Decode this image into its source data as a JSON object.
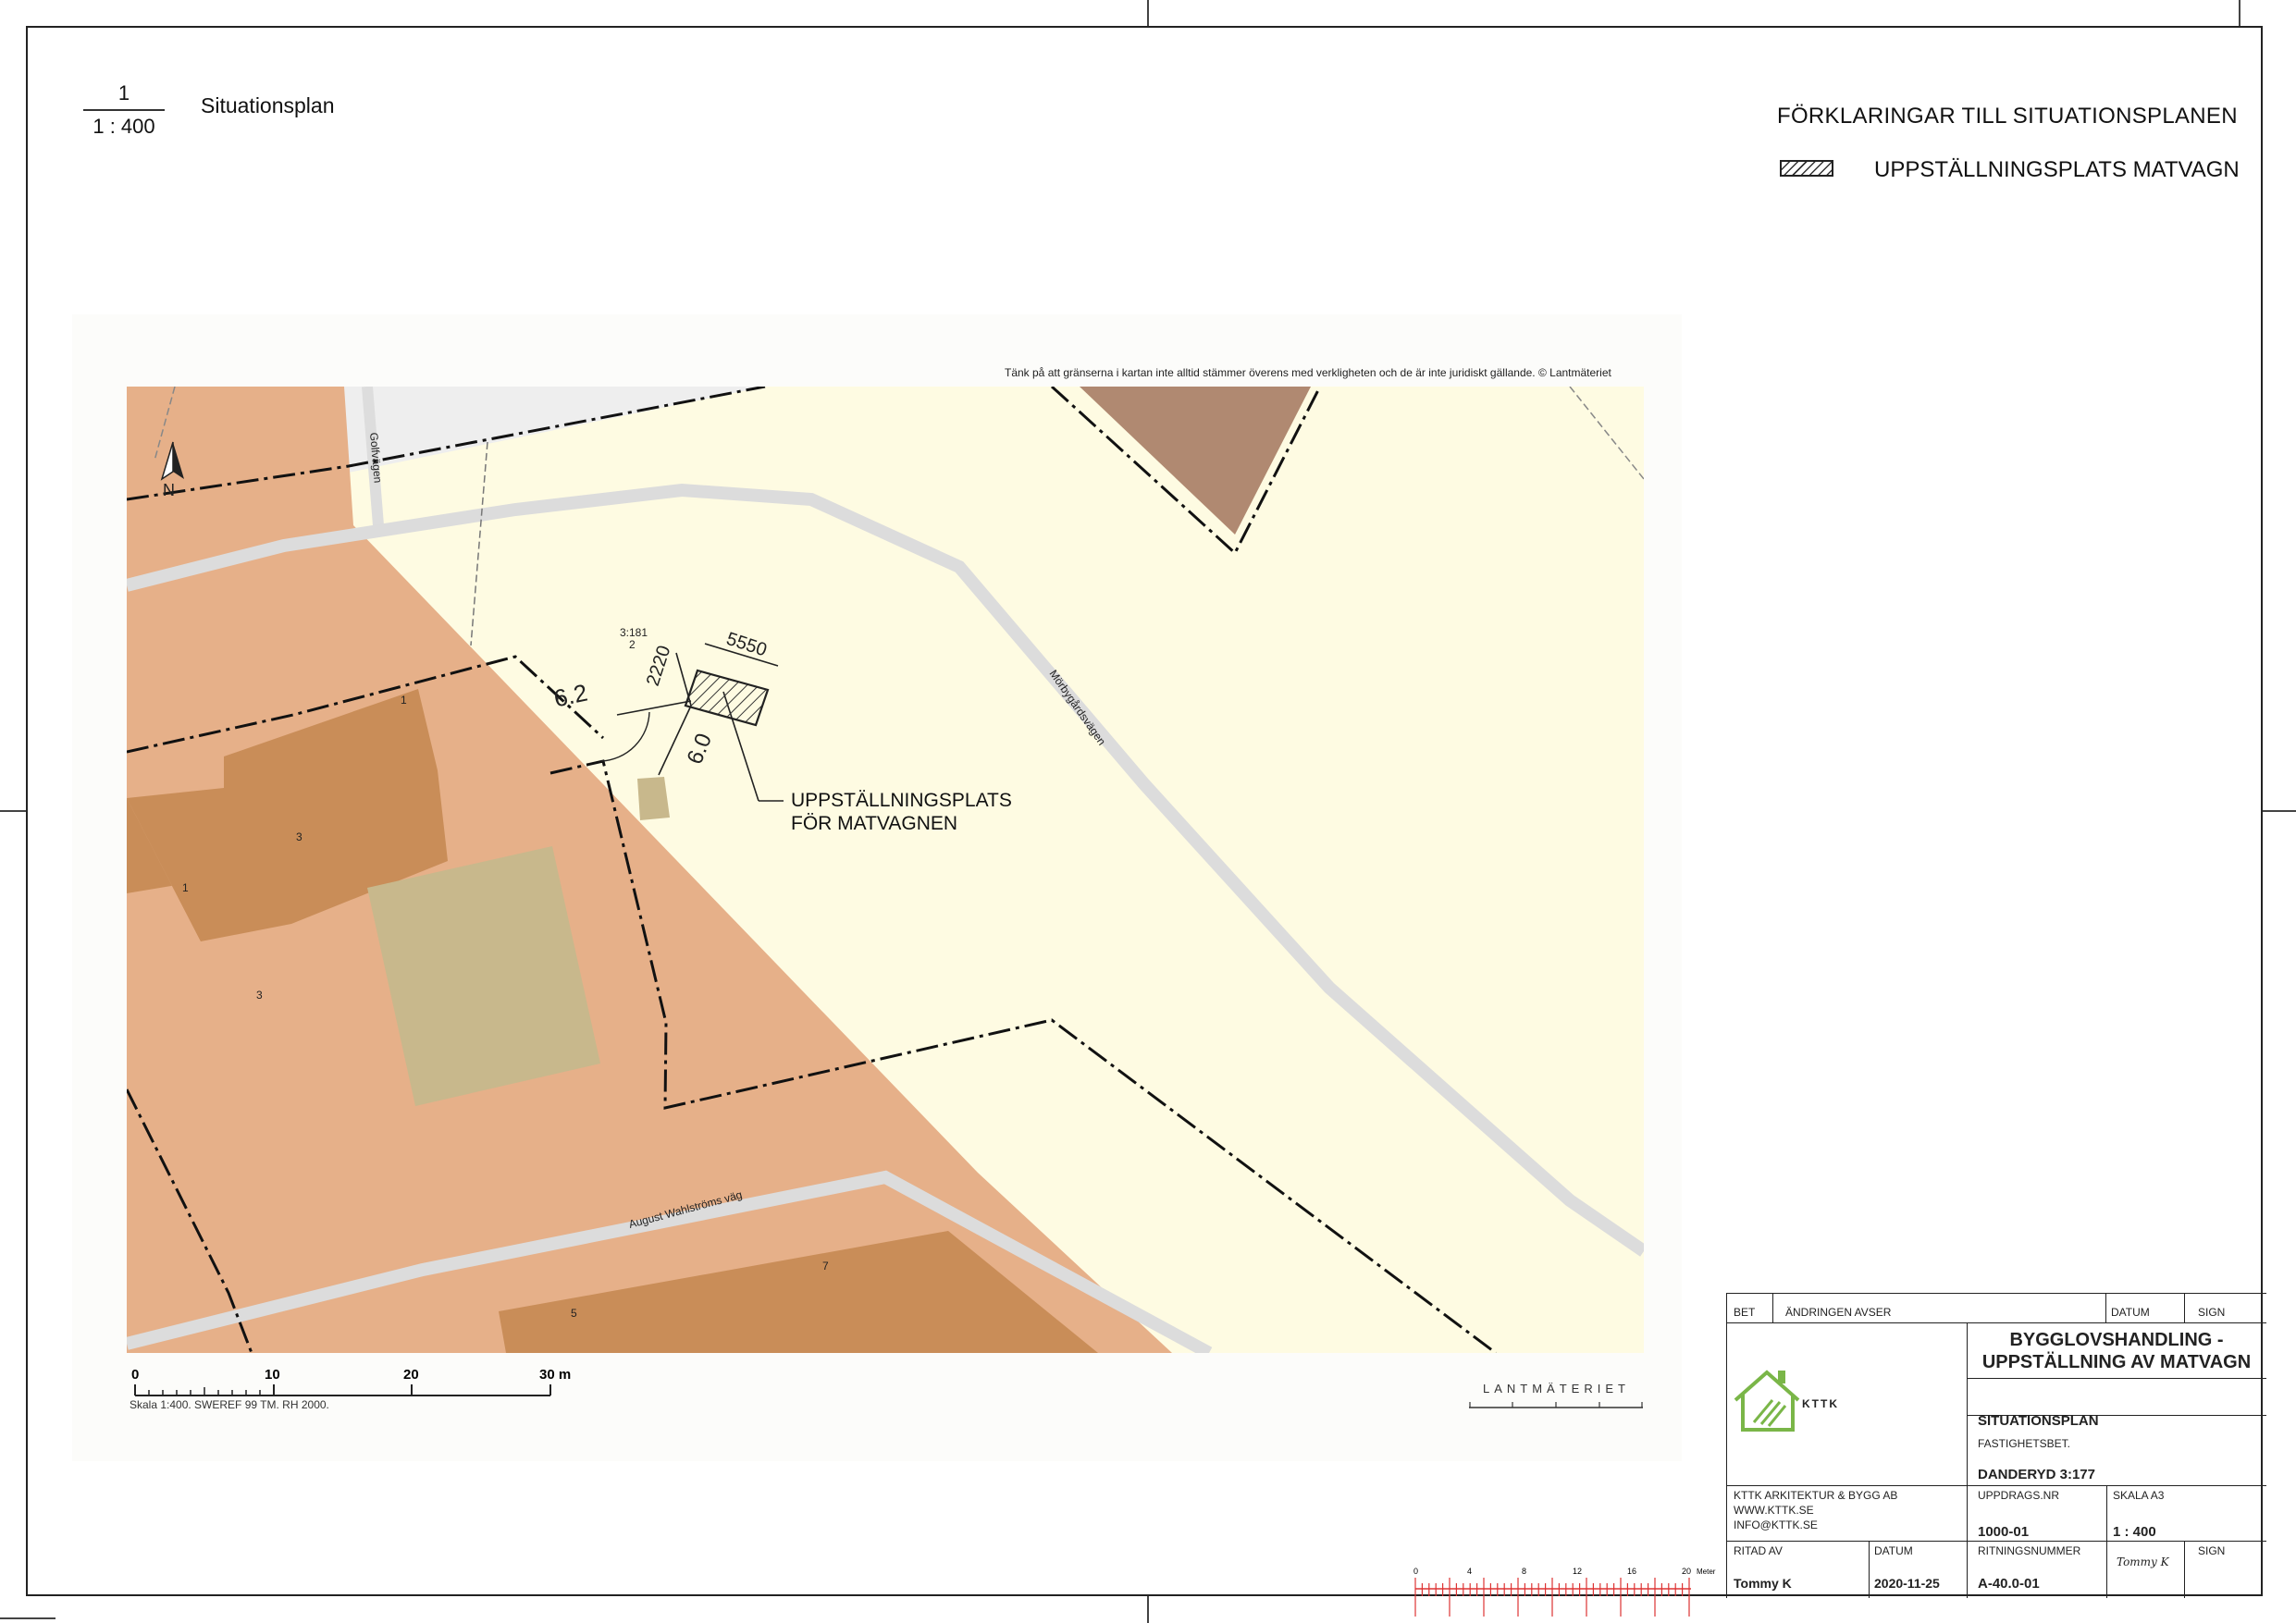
{
  "sheet": {
    "scale_numerator": "1",
    "scale_denominator": "1 : 400",
    "plan_title": "Situationsplan"
  },
  "legend": {
    "title": "FÖRKLARINGAR TILL SITUATIONSPLANEN",
    "items": [
      {
        "label": "UPPSTÄLLNINGSPLATS MATVAGN",
        "pattern": "hatch"
      }
    ]
  },
  "map": {
    "disclaimer": "Tänk på att gränserna i kartan inte alltid stämmer överens med verkligheten och de är inte juridiskt gällande. © Lantmäteriet",
    "north_label": "N",
    "streets": {
      "top": "Golfvägen",
      "diagonal": "Mörbygårdsvägen",
      "bottom": "August Wahlströms väg"
    },
    "property_label_line1": "3:181",
    "property_label_line2": "2",
    "dimensions": {
      "d1": "6.2",
      "d2": "2220",
      "d3": "5550",
      "d4": "6.0"
    },
    "building_numbers": [
      "1",
      "3",
      "1",
      "3",
      "7",
      "5"
    ],
    "annotation_line1": "UPPSTÄLLNINGSPLATS",
    "annotation_line2": "FÖR MATVAGNEN",
    "scalebar": {
      "ticks": [
        "0",
        "10",
        "20",
        "30 m"
      ],
      "caption": "Skala 1:400. SWEREF 99 TM. RH 2000."
    },
    "provider_logo": "LANTMÄTERIET",
    "colors": {
      "land_orange": "#e6b089",
      "building": "#c98d58",
      "green_area": "#c8b88c",
      "light_yellow": "#fefbe2",
      "roof_brown": "#b08971",
      "road": "#e0e0e0"
    }
  },
  "title_block": {
    "headers": {
      "bet": "BET",
      "andringen": "ÄNDRINGEN AVSER",
      "datum": "DATUM",
      "sign": "SIGN"
    },
    "project_title_line1": "BYGGLOVSHANDLING -",
    "project_title_line2": "UPPSTÄLLNING AV MATVAGN",
    "logo_text": "KTTK",
    "drawing_type": "SITUATIONSPLAN",
    "fastighet_label": "FASTIGHETSBET.",
    "fastighet_value": "DANDERYD 3:177",
    "company_lines": [
      "KTTK ARKITEKTUR & BYGG AB",
      "WWW.KTTK.SE",
      "INFO@KTTK.SE"
    ],
    "uppdrag_label": "UPPDRAGS.NR",
    "uppdrag_value": "1000-01",
    "skala_label": "SKALA A3",
    "skala_value": "1 : 400",
    "ritad_label": "RITAD AV",
    "ritad_value": "Tommy K",
    "datum_label": "DATUM",
    "datum_value": "2020-11-25",
    "ritningsnummer_label": "RITNINGSNUMMER",
    "ritningsnummer_value": "A-40.0-01",
    "sign_label": "SIGN",
    "sign_value": "Tommy K"
  },
  "ruler": {
    "ticks": [
      "0",
      "4",
      "8",
      "12",
      "16",
      "20"
    ],
    "unit": "Meter"
  }
}
